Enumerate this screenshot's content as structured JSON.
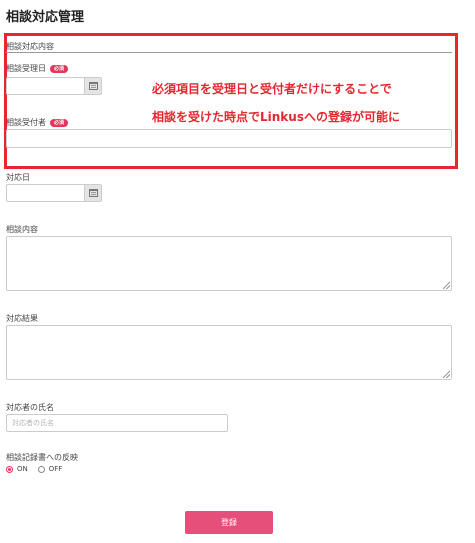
{
  "page": {
    "title": "相談対応管理"
  },
  "section": {
    "label": "相談対応内容"
  },
  "fields": {
    "received_date": {
      "label": "相談受理日",
      "badge": "必須",
      "value": ""
    },
    "receiver": {
      "label": "相談受付者",
      "badge": "必須",
      "value": ""
    },
    "response_date": {
      "label": "対応日",
      "value": ""
    },
    "consult_content": {
      "label": "相談内容",
      "value": ""
    },
    "response_result": {
      "label": "対応結果",
      "value": ""
    },
    "responder_name": {
      "label": "対応者の氏名",
      "placeholder": "対応者の氏名",
      "value": ""
    },
    "reflect_record": {
      "label": "相談記録書への反映",
      "options": [
        "ON",
        "OFF"
      ],
      "selected": "ON"
    }
  },
  "annotation": {
    "line1": "必須項目を受理日と受付者だけにすることで",
    "line2": "相談を受けた時点でLinkusへの登録が可能に",
    "color": "#e8262f"
  },
  "submit": {
    "label": "登録"
  },
  "colors": {
    "accent": "#e64f7a",
    "highlight": "#e8262f",
    "badge": "#e8335a"
  },
  "icons": {
    "date_picker": "calendar-icon"
  }
}
